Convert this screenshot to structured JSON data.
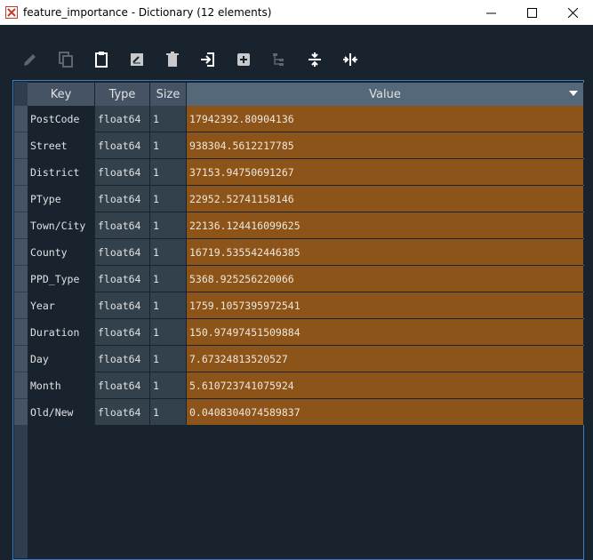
{
  "window": {
    "title": "feature_importance - Dictionary (12 elements)",
    "minimize_glyph": "–",
    "maximize_glyph": "☐",
    "close_glyph": "✕"
  },
  "toolbar": {
    "icons": [
      "edit-icon",
      "copy-icon",
      "paste-icon",
      "rename-icon",
      "delete-icon",
      "insert-icon",
      "add-icon",
      "tree-icon",
      "collapse-icon",
      "expand-icon"
    ]
  },
  "table": {
    "columns": {
      "key": "Key",
      "type": "Type",
      "size": "Size",
      "value": "Value"
    },
    "rows": [
      {
        "key": "PostCode",
        "type": "float64",
        "size": "1",
        "value": "17942392.80904136"
      },
      {
        "key": "Street",
        "type": "float64",
        "size": "1",
        "value": "938304.5612217785"
      },
      {
        "key": "District",
        "type": "float64",
        "size": "1",
        "value": "37153.94750691267"
      },
      {
        "key": "PType",
        "type": "float64",
        "size": "1",
        "value": "22952.52741158146"
      },
      {
        "key": "Town/City",
        "type": "float64",
        "size": "1",
        "value": "22136.124416099625"
      },
      {
        "key": "County",
        "type": "float64",
        "size": "1",
        "value": "16719.535542446385"
      },
      {
        "key": "PPD_Type",
        "type": "float64",
        "size": "1",
        "value": "5368.925256220066"
      },
      {
        "key": "Year",
        "type": "float64",
        "size": "1",
        "value": "1759.1057395972541"
      },
      {
        "key": "Duration",
        "type": "float64",
        "size": "1",
        "value": "150.97497451509884"
      },
      {
        "key": "Day",
        "type": "float64",
        "size": "1",
        "value": "7.67324813520527"
      },
      {
        "key": "Month",
        "type": "float64",
        "size": "1",
        "value": "5.610723741075924"
      },
      {
        "key": "Old/New",
        "type": "float64",
        "size": "1",
        "value": "0.0408304074589837"
      }
    ]
  },
  "colors": {
    "background": "#19232d",
    "value_cell": "#8c5419",
    "header": "#455364",
    "accent_border": "#3d7fc4"
  }
}
